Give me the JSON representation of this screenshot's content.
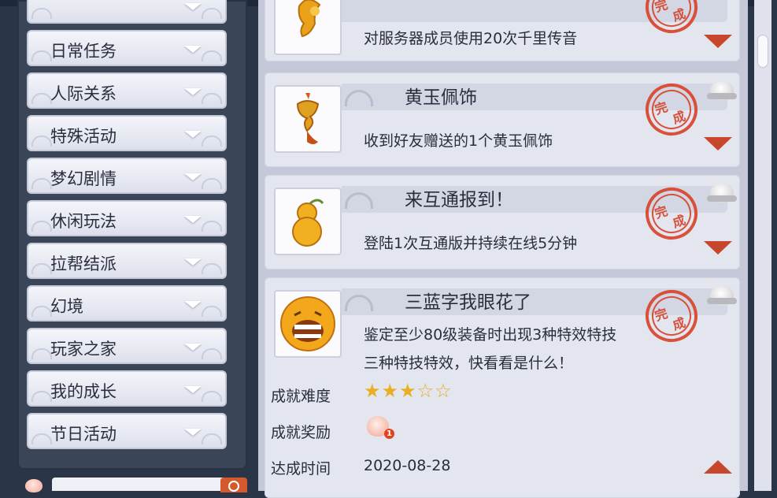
{
  "categories": [
    {
      "label": ""
    },
    {
      "label": "日常任务"
    },
    {
      "label": "人际关系"
    },
    {
      "label": "特殊活动"
    },
    {
      "label": "梦幻剧情"
    },
    {
      "label": "休闲玩法"
    },
    {
      "label": "拉帮结派"
    },
    {
      "label": "幻境"
    },
    {
      "label": "玩家之家"
    },
    {
      "label": "我的成长"
    },
    {
      "label": "节日活动"
    }
  ],
  "search": {
    "value": "",
    "placeholder": ""
  },
  "achievements": [
    {
      "title": "",
      "description": "对服务器成员使用20次千里传音",
      "status": "完成",
      "icon": "bell-icon"
    },
    {
      "title": "黄玉佩饰",
      "description": "收到好友赠送的1个黄玉佩饰",
      "status": "完成",
      "icon": "jade-pendant-icon"
    },
    {
      "title": "来互通报到！",
      "description": "登陆1次互通版并持续在线5分钟",
      "status": "完成",
      "icon": "gourd-icon"
    },
    {
      "title": "三蓝字我眼花了",
      "description_line1": "鉴定至少80级装备时出现3种特效特技",
      "description_line2": "三种特技特效，快看看是什么！",
      "status": "完成",
      "icon": "laughing-face-icon",
      "difficulty_label": "成就难度",
      "difficulty_stars": 3,
      "difficulty_max": 5,
      "reward_label": "成就奖励",
      "reward_count": "1",
      "date_label": "达成时间",
      "date_value": "2020-08-28"
    }
  ],
  "colors": {
    "accent": "#c6472b",
    "stamp": "#d8452c",
    "star": "#e8b020"
  }
}
